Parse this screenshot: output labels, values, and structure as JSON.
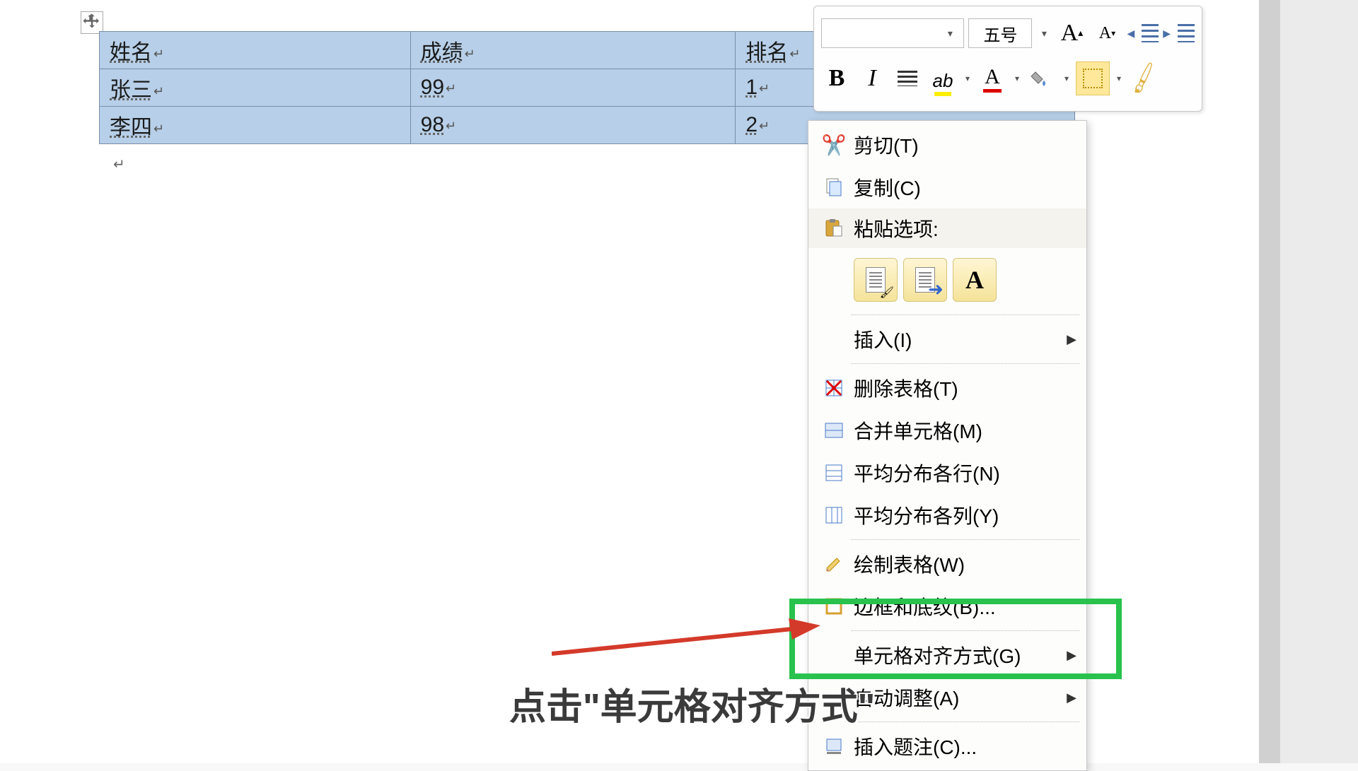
{
  "table": {
    "headers": [
      "姓名",
      "成绩",
      "排名"
    ],
    "rows": [
      [
        "张三",
        "99",
        "1"
      ],
      [
        "李四",
        "98",
        "2"
      ]
    ]
  },
  "mini_toolbar": {
    "font_name": "",
    "font_size": "五号",
    "bold": "B",
    "italic": "I",
    "grow": "A",
    "shrink": "A",
    "font_color_letter": "A",
    "highlight_pen": "ab"
  },
  "context_menu": {
    "cut": "剪切(T)",
    "copy": "复制(C)",
    "paste_header": "粘贴选项:",
    "insert": "插入(I)",
    "delete_table": "删除表格(T)",
    "merge_cells": "合并单元格(M)",
    "distribute_rows": "平均分布各行(N)",
    "distribute_cols": "平均分布各列(Y)",
    "draw_table": "绘制表格(W)",
    "borders_shading": "边框和底纹(B)...",
    "cell_alignment": "单元格对齐方式(G)",
    "autofit": "自动调整(A)",
    "insert_caption": "插入题注(C)..."
  },
  "caption": "点击\"单元格对齐方式\"",
  "colors": {
    "selection": "#b7cfe8",
    "highlight_green": "#28c24d",
    "arrow_red": "#d43a2a"
  }
}
